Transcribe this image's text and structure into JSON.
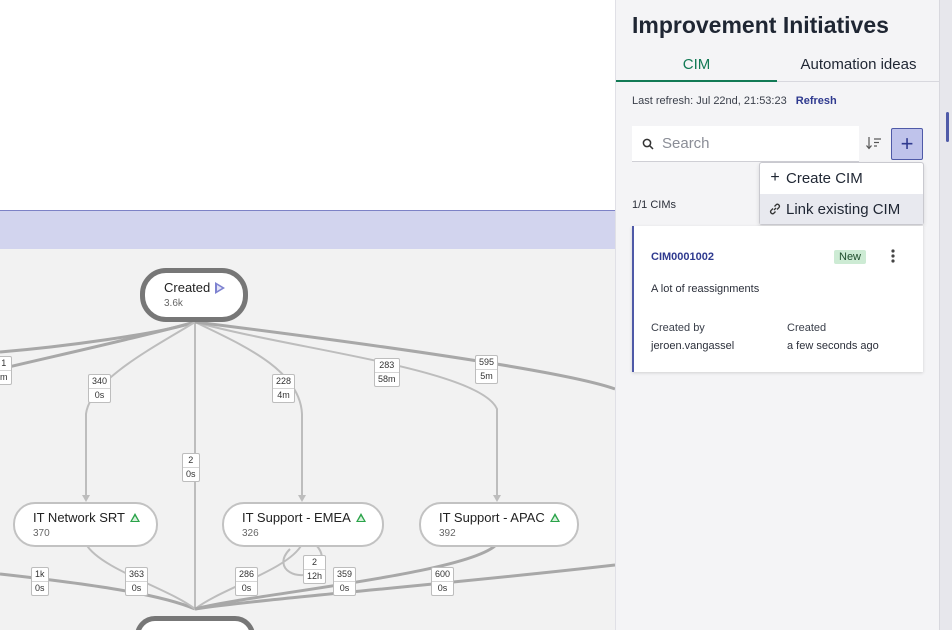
{
  "panel": {
    "title": "Improvement Initiatives",
    "tabs": [
      {
        "label": "CIM",
        "active": true
      },
      {
        "label": "Automation ideas",
        "active": false
      }
    ],
    "last_refresh": "Last refresh: Jul 22nd, 21:53:23",
    "refresh_label": "Refresh",
    "search_placeholder": "Search",
    "add_button_label": "+",
    "menu": [
      {
        "label": "Create CIM",
        "icon": "plus-icon"
      },
      {
        "label": "Link existing CIM",
        "icon": "link-icon"
      }
    ],
    "count": "1/1 CIMs",
    "card": {
      "id": "CIM0001002",
      "status": "New",
      "description": "A lot of reassignments",
      "created_by_label": "Created by",
      "created_by": "jeroen.vangassel",
      "created_label": "Created",
      "created": "a few seconds ago"
    }
  },
  "graph": {
    "nodes": [
      {
        "name": "Created",
        "count": "3.6k",
        "marker": "start-arrow-icon"
      },
      {
        "name": "IT Network SRT",
        "count": "370",
        "marker": "trend-up-icon"
      },
      {
        "name": "IT Support - EMEA",
        "count": "326",
        "marker": "trend-up-icon"
      },
      {
        "name": "IT Support - APAC",
        "count": "392",
        "marker": "trend-up-icon"
      }
    ],
    "edges": [
      {
        "a": "1",
        "b": "m"
      },
      {
        "a": "340",
        "b": "0s"
      },
      {
        "a": "2",
        "b": "0s"
      },
      {
        "a": "228",
        "b": "4m"
      },
      {
        "a": "283",
        "b": "58m"
      },
      {
        "a": "595",
        "b": "5m"
      },
      {
        "a": "1k",
        "b": "0s"
      },
      {
        "a": "363",
        "b": "0s"
      },
      {
        "a": "286",
        "b": "0s"
      },
      {
        "a": "2",
        "b": "12h"
      },
      {
        "a": "359",
        "b": "0s"
      },
      {
        "a": "600",
        "b": "0s"
      }
    ]
  },
  "colors": {
    "accent": "#4f5aa8",
    "tab_active": "#127a55",
    "band": "#d2d4ee",
    "badge_bg": "#cdebd4"
  }
}
